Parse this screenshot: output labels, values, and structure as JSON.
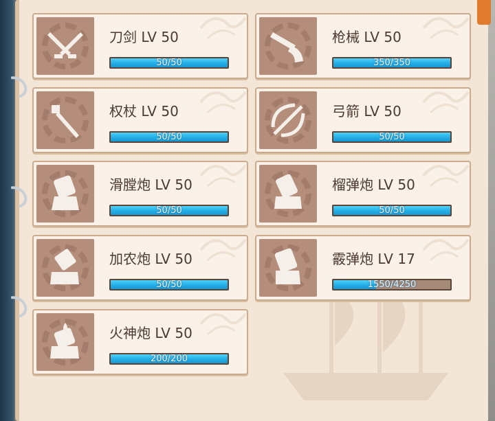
{
  "skills": [
    {
      "icon": "sword-icon",
      "title": "刀剑 LV 50",
      "progress_text": "50/50",
      "progress": 1.0
    },
    {
      "icon": "musket-icon",
      "title": "枪械 LV 50",
      "progress_text": "350/350",
      "progress": 1.0
    },
    {
      "icon": "staff-icon",
      "title": "权杖 LV 50",
      "progress_text": "50/50",
      "progress": 1.0
    },
    {
      "icon": "bow-icon",
      "title": "弓箭 LV 50",
      "progress_text": "50/50",
      "progress": 1.0
    },
    {
      "icon": "smoothbore-cannon-icon",
      "title": "滑膛炮 LV 50",
      "progress_text": "50/50",
      "progress": 1.0
    },
    {
      "icon": "grenade-cannon-icon",
      "title": "榴弹炮 LV 50",
      "progress_text": "50/50",
      "progress": 1.0
    },
    {
      "icon": "culverin-icon",
      "title": "加农炮 LV 50",
      "progress_text": "50/50",
      "progress": 1.0
    },
    {
      "icon": "shrapnel-cannon-icon",
      "title": "霰弹炮 LV 17",
      "progress_text": "1550/4250",
      "progress": 0.365
    },
    {
      "icon": "vulcan-cannon-icon",
      "title": "火神炮 LV 50",
      "progress_text": "200/200",
      "progress": 1.0
    }
  ],
  "colors": {
    "progress_fill": "#22aee6",
    "progress_empty": "#a68a78",
    "icon_bg": "#b48e7b",
    "card_bg": "#faf2e8",
    "page_bg": "#f3e6d6"
  }
}
